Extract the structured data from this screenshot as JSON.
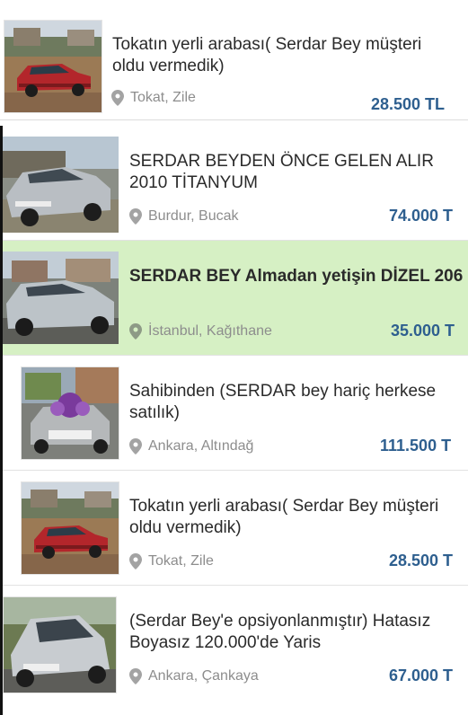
{
  "listings": [
    {
      "title": "Tokatın yerli arabası( Serdar Bey müşteri oldu vermedik)",
      "location": "Tokat, Zile",
      "price": "28.500 TL",
      "thumb": "red-sedan"
    },
    {
      "title": "SERDAR BEYDEN ÖNCE GELEN ALIR 2010 TİTANYUM",
      "location": "Burdur, Bucak",
      "price": "74.000 T",
      "thumb": "silver-focus"
    },
    {
      "title": "SERDAR BEY Almadan yetişin DİZEL 206",
      "location": "İstanbul, Kağıthane",
      "price": "35.000 T",
      "thumb": "silver-206",
      "highlighted": true
    },
    {
      "title": "Sahibinden (SERDAR bey hariç herkese satılık)",
      "location": "Ankara, Altındağ",
      "price": "111.500 T",
      "thumb": "wedding-car"
    },
    {
      "title": "Tokatın yerli arabası( Serdar Bey müşteri oldu vermedik)",
      "location": "Tokat, Zile",
      "price": "28.500 T",
      "thumb": "red-sedan"
    },
    {
      "title": "(Serdar Bey'e opsiyonlanmıştır) Hatasız Boyasız 120.000'de Yaris",
      "location": "Ankara, Çankaya",
      "price": "67.000 T",
      "thumb": "silver-yaris"
    }
  ]
}
